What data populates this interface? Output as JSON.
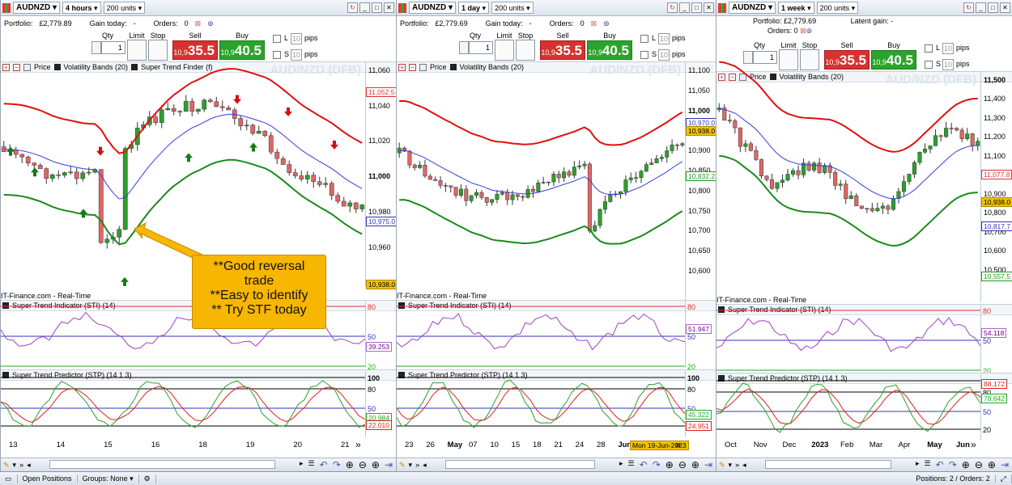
{
  "panels": [
    {
      "symbol": "AUDNZD",
      "timeframe": "4 hours",
      "units": "200 units",
      "portfolio_label": "Portfolio:",
      "portfolio": "£2,779.89",
      "latent_label": "Gain today:",
      "latent": "-",
      "orders_label": "Orders:",
      "orders": "0",
      "ticket": {
        "qty_label": "Qty",
        "qty": "1",
        "limit": "Limit",
        "stop": "Stop",
        "sell_label": "Sell",
        "buy_label": "Buy",
        "sell_small": "10,9",
        "sell_big": "35.5",
        "buy_small": "10,9",
        "buy_big": "40.5",
        "l": "L",
        "s": "S",
        "pips": "pips",
        "pipval": "10"
      },
      "legend": [
        "Price",
        "Volatility Bands (20)",
        "Super Trend Finder (f)"
      ],
      "watermark": "AUD/NZD (DFB)",
      "yaxis": [
        "11,060",
        "11,040",
        "11,020",
        "11,000",
        "10,980",
        "10,960"
      ],
      "tags": [
        {
          "t": "11,052.5",
          "c": "#d33"
        },
        {
          "t": "10,975.0",
          "c": "#33b"
        },
        {
          "t": "10,938.0",
          "c": "y"
        }
      ],
      "source": "IT-Finance.com - Real-Time",
      "sti": {
        "title": "Super Trend Indicator (STI) (14)",
        "l80": "80",
        "l50": "50",
        "l20": "20",
        "tag": "39.253"
      },
      "stp": {
        "title": "Super Trend Predictor (STP) (14 1 3)",
        "l100": "100",
        "l80": "80",
        "l50": "50",
        "l20": "20",
        "tag1": "20.984",
        "tag2": "22.010"
      },
      "xaxis": [
        "13",
        "14",
        "15",
        "16",
        "18",
        "19",
        "20",
        "21"
      ]
    },
    {
      "symbol": "AUDNZD",
      "timeframe": "1 day",
      "units": "200 units",
      "portfolio_label": "Portfolio:",
      "portfolio": "£2,779.69",
      "latent_label": "Gain today:",
      "latent": "-",
      "orders_label": "Orders:",
      "orders": "0",
      "ticket": {
        "qty_label": "Qty",
        "qty": "1",
        "limit": "Limit",
        "stop": "Stop",
        "sell_label": "Sell",
        "buy_label": "Buy",
        "sell_small": "10,9",
        "sell_big": "35.5",
        "buy_small": "10,9",
        "buy_big": "40.5",
        "l": "L",
        "s": "S",
        "pips": "pips",
        "pipval": "10"
      },
      "legend": [
        "Price",
        "Volatility Bands (20)"
      ],
      "watermark": "AUD/NZD (DFB)",
      "yaxis": [
        "11,100",
        "11,050",
        "11,000",
        "10,950",
        "10,900",
        "10,850",
        "10,800",
        "10,750",
        "10,700",
        "10,650",
        "10,600"
      ],
      "tags": [
        {
          "t": "10,970.0",
          "c": "#33b"
        },
        {
          "t": "10,938.0",
          "c": "y"
        },
        {
          "t": "10,832.2",
          "c": "#292"
        }
      ],
      "source": "IT-Finance.com - Real-Time",
      "sti": {
        "title": "Super Trend Indicator (STI) (14)",
        "l80": "80",
        "l50": "50",
        "l20": "20",
        "tag": "51.947"
      },
      "stp": {
        "title": "Super Trend Predictor (STP) (14 1 3)",
        "l100": "100",
        "l80": "80",
        "l50": "50",
        "l20": "20",
        "tag1": "45.322",
        "tag2": "24.951"
      },
      "xaxis": [
        "23",
        "26",
        "May",
        "07",
        "10",
        "15",
        "18",
        "21",
        "24",
        "28",
        "Jun",
        "07",
        "11"
      ],
      "date_tag": "Mon 19-Jun-2023"
    },
    {
      "symbol": "AUDNZD",
      "timeframe": "1 week",
      "units": "200 units",
      "portfolio_label": "Portfolio:",
      "portfolio": "£2,779.69",
      "latent_label": "Latent gain:",
      "latent": "-",
      "orders_label": "Orders:",
      "orders": "0",
      "ticket": {
        "qty_label": "Qty",
        "qty": "1",
        "limit": "Limit",
        "stop": "Stop",
        "sell_label": "Sell",
        "buy_label": "Buy",
        "sell_small": "10,9",
        "sell_big": "35.5",
        "buy_small": "10,9",
        "buy_big": "40.5",
        "l": "L",
        "s": "S",
        "pips": "pips",
        "pipval": "10"
      },
      "legend": [
        "Price",
        "Volatility Bands (20)"
      ],
      "watermark": "AUD/NZD (DFB)",
      "yaxis": [
        "11,500",
        "11,400",
        "11,300",
        "11,200",
        "11,100",
        "11,000",
        "10,900",
        "10,800",
        "10,700",
        "10,600",
        "10,500"
      ],
      "tags": [
        {
          "t": "11,077.8",
          "c": "#d33"
        },
        {
          "t": "10,938.0",
          "c": "y"
        },
        {
          "t": "10,817.7",
          "c": "#33b"
        },
        {
          "t": "10,557.5",
          "c": "#292"
        }
      ],
      "source": "IT-Finance.com - Real-Time",
      "sti": {
        "title": "Super Trend Indicator (STI) (14)",
        "l80": "80",
        "l50": "50",
        "l20": "20",
        "tag": "54.118"
      },
      "stp": {
        "title": "Super Trend Predictor (STP) (14 1 3)",
        "l100": "",
        "l80": "80",
        "l50": "50",
        "l20": "20",
        "tag1": "88.172",
        "tag2": "78.642"
      },
      "xaxis": [
        "Oct",
        "Nov",
        "Dec",
        "2023",
        "Feb",
        "Mar",
        "Apr",
        "May",
        "Jun"
      ]
    }
  ],
  "callout": {
    "l1": "**Good reversal",
    "l2": "trade",
    "l3": "**Easy to identify",
    "l4": "** Try STF today"
  },
  "statusbar": {
    "open_positions": "Open Positions",
    "groups": "Groups: None",
    "right": "Positions: 2 / Orders: 2"
  },
  "colors": {
    "up": "#2ca02c",
    "down": "#e06666",
    "upper_band": "#e01010",
    "mid_band": "#3a3adf",
    "lower_band": "#1a8a1a",
    "sti": "#a040c0",
    "stp_fast": "#2ca02c",
    "stp_slow": "#e02020"
  }
}
